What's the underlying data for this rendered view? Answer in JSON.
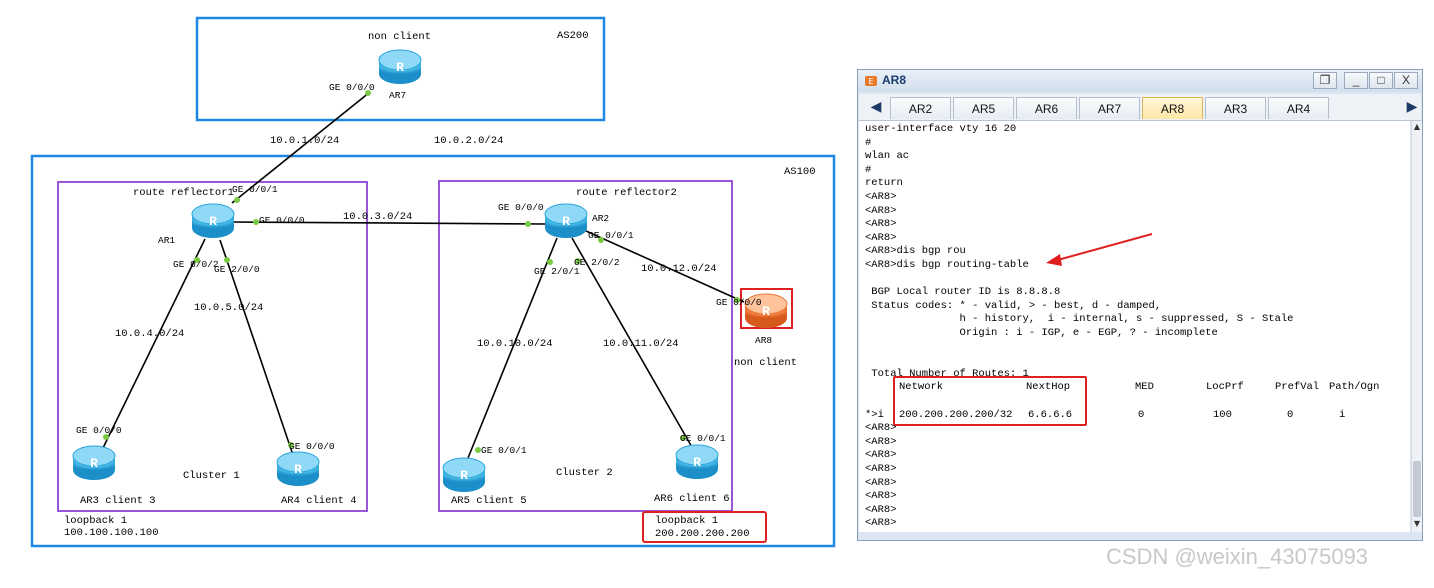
{
  "topology": {
    "as200": {
      "label": "AS200",
      "ar7": {
        "name": "AR7",
        "role": "non client",
        "port": "GE 0/0/0"
      }
    },
    "links": {
      "ar7_ar1": "10.0.1.0/24",
      "ar7_ar2": "10.0.2.0/24",
      "ar1_ar2": "10.0.3.0/24",
      "ar1_ar3": "10.0.4.0/24",
      "ar1_ar4": "10.0.5.0/24",
      "ar2_ar5": "10.0.10.0/24",
      "ar2_ar6": "10.0.11.0/24",
      "ar2_ar8": "10.0.12.0/24"
    },
    "as100": {
      "label": "AS100",
      "cluster1": {
        "label": "Cluster 1",
        "rr_label": "route reflector1",
        "ar1": {
          "name": "AR1",
          "port_up": "GE 0/0/1",
          "port_right": "GE 0/0/0",
          "port_left": "GE 0/0/2",
          "port_down": "GE 2/0/0"
        },
        "ar3": {
          "label": "AR3 client 3",
          "port": "GE 0/0/0"
        },
        "ar4": {
          "label": "AR4 client 4",
          "port": "GE 0/0/0"
        },
        "loopback_label": "loopback 1",
        "loopback_ip": "100.100.100.100"
      },
      "cluster2": {
        "label": "Cluster 2",
        "rr_label": "route reflector2",
        "ar2": {
          "name": "AR2",
          "port_left": "GE 0/0/0",
          "port_right": "GE 0/0/1",
          "port_down_left": "GE 2/0/1",
          "port_down_right": "GE 2/0/2"
        },
        "ar5": {
          "label": "AR5 client 5",
          "port": "GE 0/0/1"
        },
        "ar6": {
          "label": "AR6 client 6",
          "port": "GE 0/0/1"
        },
        "loopback_label": "loopback 1",
        "loopback_ip": "200.200.200.200"
      },
      "ar8": {
        "name": "AR8",
        "role": "non client",
        "port": "GE 0/0/0"
      }
    },
    "router_glyph": "R"
  },
  "terminal": {
    "title": "AR8",
    "window_buttons": {
      "restore": "❐",
      "minimize": "_",
      "maximize": "□",
      "close": "X"
    },
    "tabs": [
      {
        "label": "AR2",
        "active": false
      },
      {
        "label": "AR5",
        "active": false
      },
      {
        "label": "AR6",
        "active": false
      },
      {
        "label": "AR7",
        "active": false
      },
      {
        "label": "AR8",
        "active": true
      },
      {
        "label": "AR3",
        "active": false
      },
      {
        "label": "AR4",
        "active": false
      }
    ],
    "lines": [
      "user-interface vty 16 20",
      "#",
      "wlan ac",
      "#",
      "return",
      "<AR8>",
      "<AR8>",
      "<AR8>",
      "<AR8>",
      "<AR8>dis bgp rou",
      "<AR8>dis bgp routing-table",
      "",
      " BGP Local router ID is 8.8.8.8",
      " Status codes: * - valid, > - best, d - damped,",
      "               h - history,  i - internal, s - suppressed, S - Stale",
      "               Origin : i - IGP, e - EGP, ? - incomplete",
      "",
      "",
      " Total Number of Routes: 1"
    ],
    "route_table": {
      "headers": [
        "Network",
        "NextHop",
        "MED",
        "LocPrf",
        "PrefVal",
        "Path/Ogn"
      ],
      "row": {
        "status": "*>i",
        "network": "200.200.200.200/32",
        "nexthop": "6.6.6.6",
        "med": "0",
        "locprf": "100",
        "prefval": "0",
        "path": "i"
      }
    },
    "trailing_prompts": [
      "<AR8>",
      "<AR8>",
      "<AR8>",
      "<AR8>",
      "<AR8>",
      "<AR8>",
      "<AR8>",
      "<AR8>"
    ]
  },
  "watermark": "CSDN @weixin_43075093",
  "colors": {
    "as_border": "#1e88e5",
    "cluster_border": "#8e44d6",
    "highlight": "#e02020",
    "router": "#3fb6e8",
    "router_ar8": "#f47c3c",
    "port_dot": "#7ac943"
  }
}
